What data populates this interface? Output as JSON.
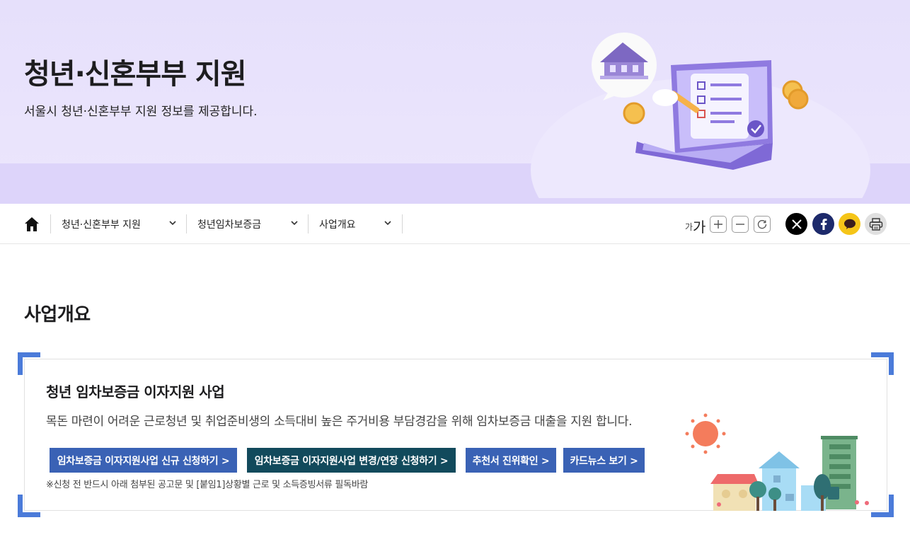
{
  "hero": {
    "title": "청년·신혼부부 지원",
    "subtitle": "서울시 청년·신혼부부 지원 정보를 제공합니다."
  },
  "nav": {
    "home_icon": "home-icon",
    "items": [
      {
        "label": "청년·신혼부부 지원"
      },
      {
        "label": "청년임차보증금"
      },
      {
        "label": "사업개요"
      }
    ],
    "font_small_label": "가",
    "font_big_label": "가",
    "tools": [
      "zoom-in-icon",
      "zoom-out-icon",
      "reset-icon"
    ],
    "share": [
      "x-icon",
      "facebook-icon",
      "kakaotalk-icon",
      "print-icon"
    ]
  },
  "main": {
    "section_title": "사업개요",
    "card": {
      "title": "청년 임차보증금 이자지원 사업",
      "description": "목돈 마련이 어려운 근로청년 및 취업준비생의 소득대비 높은 주거비용 부담경감을 위해 임차보증금 대출을 지원 합니다.",
      "buttons": [
        {
          "label": "임차보증금 이자지원사업 신규 신청하기 >"
        },
        {
          "label": "임차보증금 이자지원사업 변경/연장 신청하기 >"
        },
        {
          "label": "추천서 진위확인 >"
        },
        {
          "label": "카드뉴스 보기 >"
        }
      ],
      "note": "※신청 전 반드시 아래 첨부된 공고문 및 [붙임1]상황별 근로 및 소득증빙서류 필독바람"
    }
  },
  "colors": {
    "accent_blue": "#3a62b5",
    "accent_dark": "#124a5c",
    "corner_blue": "#4b7bd9",
    "hero_bg": "#e6e0fb"
  }
}
